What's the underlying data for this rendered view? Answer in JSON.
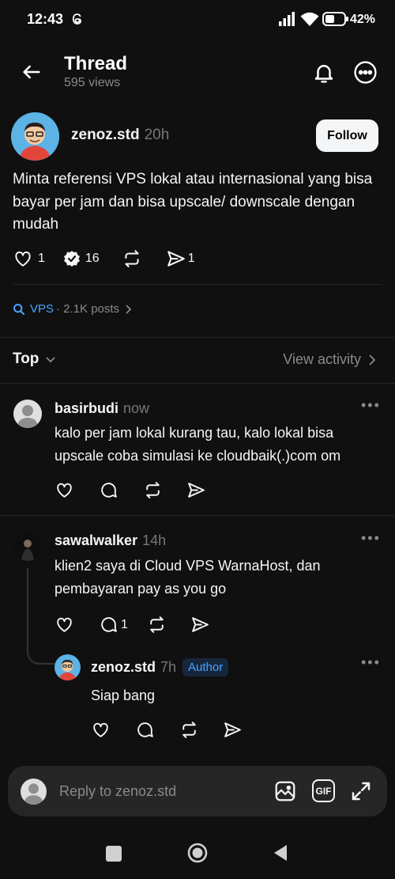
{
  "status_bar": {
    "time": "12:43",
    "battery": "42%"
  },
  "header": {
    "title": "Thread",
    "views": "595 views"
  },
  "post": {
    "username": "zenoz.std",
    "time": "20h",
    "follow_label": "Follow",
    "text": "Minta referensi VPS lokal atau internasional yang bisa bayar per jam dan bisa upscale/ downscale dengan mudah",
    "likes": "1",
    "replies": "16",
    "shares": "1"
  },
  "topic": {
    "tag": "VPS",
    "posts": "· 2.1K posts"
  },
  "sort": {
    "label": "Top",
    "view_activity": "View activity"
  },
  "comments": [
    {
      "username": "basirbudi",
      "time": "now",
      "text": "kalo per jam lokal kurang tau, kalo lokal bisa upscale coba simulasi ke cloudbaik(.)com om"
    },
    {
      "username": "sawalwalker",
      "time": "14h",
      "text": "klien2 saya di Cloud VPS WarnaHost, dan pembayaran pay as you go",
      "reply_count": "1"
    }
  ],
  "nested_reply": {
    "username": "zenoz.std",
    "time": "7h",
    "badge": "Author",
    "text": "Siap bang"
  },
  "reply_bar": {
    "placeholder": "Reply to zenoz.std",
    "gif_label": "GIF"
  }
}
